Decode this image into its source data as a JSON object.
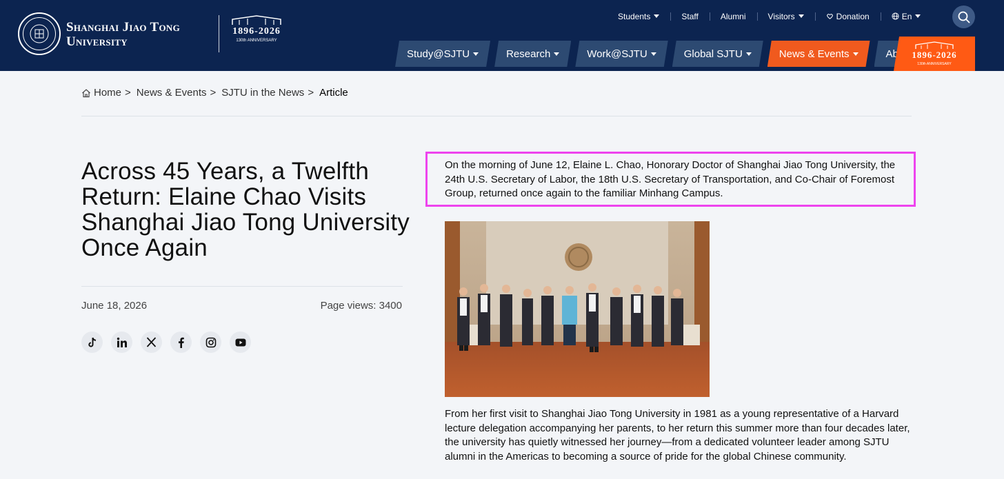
{
  "header": {
    "logo_line1": "Shanghai Jiao Tong",
    "logo_line2": "University",
    "anniversary_years": "1896-2026",
    "anniversary_sub": "130th ANNIVERSARY",
    "top_links": [
      {
        "label": "Students",
        "dropdown": true
      },
      {
        "label": "Staff",
        "dropdown": false
      },
      {
        "label": "Alumni",
        "dropdown": false
      },
      {
        "label": "Visitors",
        "dropdown": true
      },
      {
        "label": "Donation",
        "icon": "donation-icon"
      },
      {
        "label": "En",
        "icon": "globe-icon",
        "dropdown": true
      }
    ],
    "main_nav": [
      {
        "label": "Study@SJTU",
        "active": false
      },
      {
        "label": "Research",
        "active": false
      },
      {
        "label": "Work@SJTU",
        "active": false
      },
      {
        "label": "Global SJTU",
        "active": false
      },
      {
        "label": "News & Events",
        "active": true
      },
      {
        "label": "About Us",
        "active": false
      }
    ]
  },
  "breadcrumb": {
    "home": "Home",
    "level1": "News & Events",
    "level2": "SJTU in the News",
    "current": "Article",
    "separator": ">"
  },
  "article": {
    "title": "Across 45 Years, a Twelfth Return: Elaine Chao Visits Shanghai Jiao Tong University Once Again",
    "date": "June 18, 2026",
    "views": "Page views: 3400",
    "intro": "On the morning of June 12, Elaine L. Chao, Honorary Doctor of Shanghai Jiao Tong University, the 24th U.S. Secretary of Labor, the 18th U.S. Secretary of Transportation, and Co-Chair of Foremost Group, returned once again to the familiar Minhang Campus.",
    "body": "From her first visit to Shanghai Jiao Tong University in 1981 as a young representative of a Harvard lecture delegation accompanying her parents, to her return this summer more than four decades later, the university has quietly witnessed her journey—from a dedicated volunteer leader among SJTU alumni in the Americas to becoming a source of pride for the global Chinese community."
  },
  "social": [
    "tiktok-icon",
    "linkedin-icon",
    "x-icon",
    "facebook-icon",
    "instagram-icon",
    "youtube-icon"
  ],
  "colors": {
    "header_bg": "#0c2450",
    "nav_item_bg": "#2d4a72",
    "accent": "#f05a1e",
    "highlight_border": "#ee44ee"
  }
}
